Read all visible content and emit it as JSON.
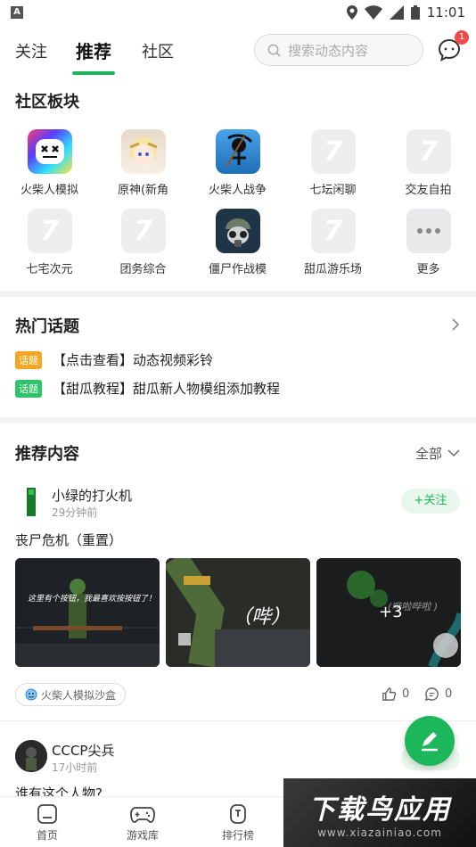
{
  "status_bar": {
    "time": "11:01"
  },
  "top_nav": {
    "tabs": [
      {
        "label": "关注"
      },
      {
        "label": "推荐",
        "active": true
      },
      {
        "label": "社区"
      }
    ],
    "search_placeholder": "搜索动态内容",
    "message_badge": "1"
  },
  "community": {
    "title": "社区板块",
    "boards": [
      {
        "label": "火柴人模拟",
        "icon": "stickman-face-icon"
      },
      {
        "label": "原神(新角",
        "icon": "anime-girl-icon"
      },
      {
        "label": "火柴人战争",
        "icon": "stick-war-icon"
      },
      {
        "label": "七坛闲聊",
        "icon": "placeholder-icon"
      },
      {
        "label": "交友自拍",
        "icon": "placeholder-icon"
      },
      {
        "label": "七宅次元",
        "icon": "placeholder-icon"
      },
      {
        "label": "团务综合",
        "icon": "placeholder-icon"
      },
      {
        "label": "僵尸作战模",
        "icon": "gasmask-soldier-icon"
      },
      {
        "label": "甜瓜游乐场",
        "icon": "placeholder-icon"
      },
      {
        "label": "更多",
        "icon": "more-icon"
      }
    ]
  },
  "hot_topics": {
    "title": "热门话题",
    "items": [
      {
        "tag": "话题",
        "tag_color": "#f5a623",
        "text": "【点击查看】动态视频彩铃"
      },
      {
        "tag": "话题",
        "tag_color": "#2ec46b",
        "text": "【甜瓜教程】甜瓜新人物模组添加教程"
      }
    ]
  },
  "recommended": {
    "title": "推荐内容",
    "filter": "全部",
    "posts": [
      {
        "author": "小绿的打火机",
        "time": "29分钟前",
        "follow_label": "+关注",
        "text": "丧尸危机（重置）",
        "images": [
          {
            "caption": "这里有个按钮，我最喜欢按按钮了！"
          },
          {
            "caption": "（哔）"
          },
          {
            "caption": "(哔啦哔啦 )",
            "more": "+3"
          }
        ],
        "board_chip": "火柴人模拟沙盒",
        "likes": "0",
        "comments": "0"
      },
      {
        "author": "CCCP尖兵",
        "time": "17小时前",
        "text": "谁有这个人物?"
      }
    ]
  },
  "bottom_nav": {
    "items": [
      {
        "label": "首页"
      },
      {
        "label": "游戏库"
      },
      {
        "label": "排行榜"
      }
    ]
  },
  "watermark": {
    "main": "下载鸟应用",
    "sub": "www.xiazainiao.com"
  },
  "colors": {
    "accent": "#1fb45b",
    "badge": "#f04b4b"
  }
}
